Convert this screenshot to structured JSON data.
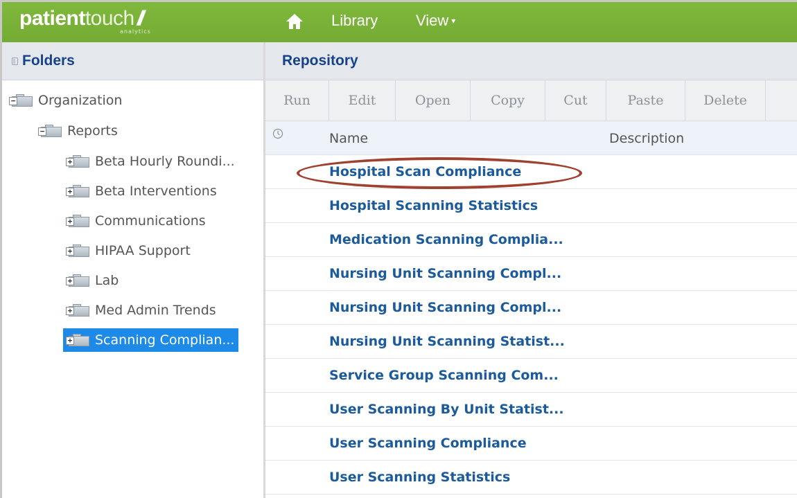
{
  "app": {
    "logo_bold": "patient",
    "logo_light": "touch",
    "logo_slashes": "//",
    "logo_sub": "analytics"
  },
  "nav": {
    "library": "Library",
    "view": "View",
    "view_caret": "▾"
  },
  "folders": {
    "title": "Folders",
    "tree": [
      {
        "label": "Organization",
        "expander": "−",
        "level": 0,
        "selected": false
      },
      {
        "label": "Reports",
        "expander": "−",
        "level": 1,
        "selected": false
      },
      {
        "label": "Beta Hourly Roundi...",
        "expander": "+",
        "level": 2,
        "selected": false
      },
      {
        "label": "Beta Interventions",
        "expander": "+",
        "level": 2,
        "selected": false
      },
      {
        "label": "Communications",
        "expander": "+",
        "level": 2,
        "selected": false
      },
      {
        "label": "HIPAA Support",
        "expander": "+",
        "level": 2,
        "selected": false
      },
      {
        "label": "Lab",
        "expander": "+",
        "level": 2,
        "selected": false
      },
      {
        "label": "Med Admin Trends",
        "expander": "+",
        "level": 2,
        "selected": false
      },
      {
        "label": "Scanning Complian...",
        "expander": "+",
        "level": 2,
        "selected": true
      }
    ]
  },
  "repository": {
    "title": "Repository",
    "toolbar": [
      "Run",
      "Edit",
      "Open",
      "Copy",
      "Cut",
      "Paste",
      "Delete"
    ],
    "columns": {
      "name": "Name",
      "description": "Description"
    },
    "rows": [
      {
        "name": "Hospital Scan Compliance",
        "description": "",
        "highlighted": true
      },
      {
        "name": "Hospital Scanning Statistics",
        "description": ""
      },
      {
        "name": "Medication Scanning Complia...",
        "description": ""
      },
      {
        "name": "Nursing Unit Scanning Compl...",
        "description": ""
      },
      {
        "name": "Nursing Unit Scanning Compl...",
        "description": ""
      },
      {
        "name": "Nursing Unit Scanning Statist...",
        "description": ""
      },
      {
        "name": "Service Group Scanning Com...",
        "description": ""
      },
      {
        "name": "User Scanning By Unit Statist...",
        "description": ""
      },
      {
        "name": "User Scanning Compliance",
        "description": ""
      },
      {
        "name": "User Scanning Statistics",
        "description": ""
      }
    ]
  },
  "colors": {
    "topbar": "#7cb33a",
    "panel_header_text": "#15428b",
    "link": "#1b5a9b",
    "selection": "#1e8ae8",
    "annotation": "#a0412f"
  }
}
